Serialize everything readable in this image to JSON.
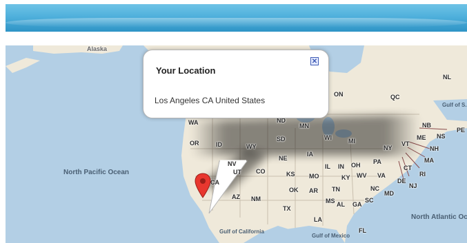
{
  "header": {
    "color_top": "#6ec3e6",
    "color_bottom": "#2f94c6"
  },
  "map": {
    "land_color": "#efe9da",
    "water_color": "#b3cfe5",
    "labels": {
      "alaska": "Alaska",
      "on": "ON",
      "qc": "QC",
      "nl": "NL",
      "gulf_st_lawrence": "Gulf of S. Lawrence",
      "nb": "NB",
      "pe": "PE",
      "ns": "NS",
      "wa": "WA",
      "nd": "ND",
      "mn": "MN",
      "or": "OR",
      "id": "ID",
      "wy": "WY",
      "sd": "SD",
      "wi": "WI",
      "mi": "MI",
      "vt": "VT",
      "me": "ME",
      "ny": "NY",
      "nh": "NH",
      "ma": "MA",
      "nv": "NV",
      "ne": "NE",
      "ia": "IA",
      "il": "IL",
      "in": "IN",
      "oh": "OH",
      "pa": "PA",
      "ct": "CT",
      "ri": "RI",
      "ca": "CA",
      "ut": "UT",
      "co": "CO",
      "ks": "KS",
      "mo": "MO",
      "ky": "KY",
      "wv": "WV",
      "va": "VA",
      "nj": "NJ",
      "de": "DE",
      "md": "MD",
      "az": "AZ",
      "nm": "NM",
      "ok": "OK",
      "ar": "AR",
      "tn": "TN",
      "nc": "NC",
      "sc": "SC",
      "ms": "MS",
      "al": "AL",
      "ga": "GA",
      "tx": "TX",
      "la": "LA",
      "fl": "FL",
      "north_pacific": "North Pacific Ocean",
      "north_atlantic": "North Atlantic Ocean",
      "gulf_california": "Gulf of California",
      "gulf_mexico": "Gulf of Mexico"
    }
  },
  "info_window": {
    "title": "Your Location",
    "location": "Los Angeles CA United States",
    "close_symbol": "✕"
  },
  "marker": {
    "color": "#e8372f",
    "icon": "map-pin-icon"
  }
}
